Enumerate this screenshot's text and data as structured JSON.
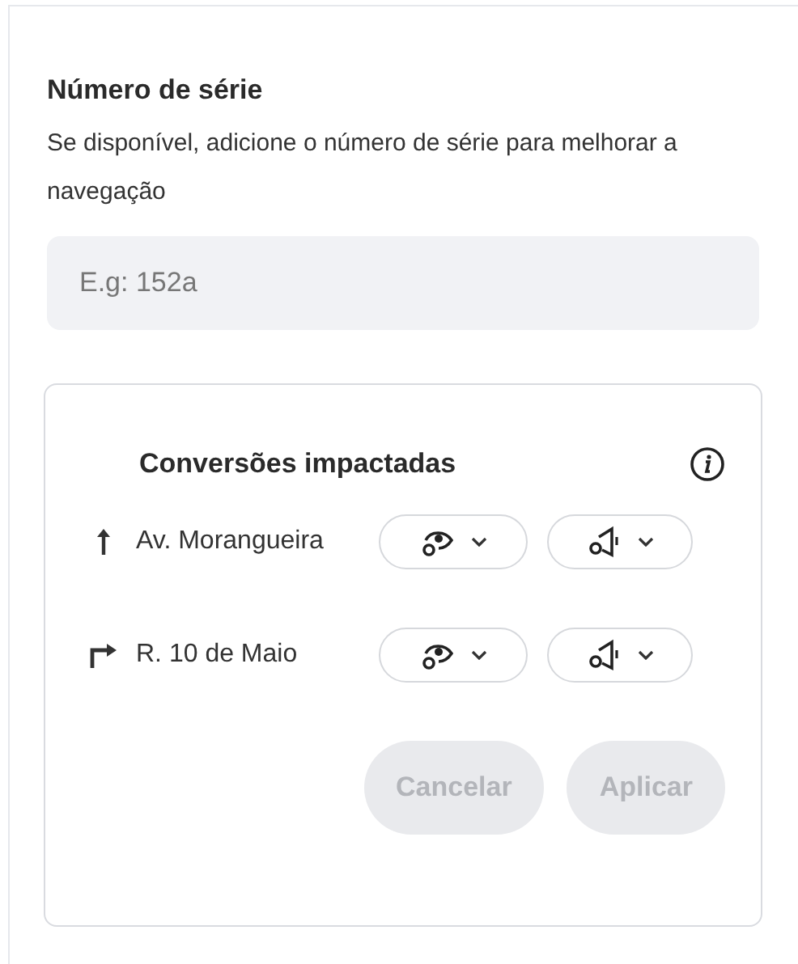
{
  "serial": {
    "title": "Número de série",
    "description": "Se disponível, adicione o número de série para melhorar a navegação",
    "placeholder": "E.g: 152a"
  },
  "card": {
    "title": "Conversões impactadas",
    "rows": [
      {
        "kind": "straight",
        "street": "Av. Morangueira"
      },
      {
        "kind": "right",
        "street": "R. 10 de Maio"
      }
    ],
    "buttons": [
      {
        "label": "Cancelar",
        "disabled": true
      },
      {
        "label": "Aplicar",
        "disabled": true
      }
    ]
  }
}
